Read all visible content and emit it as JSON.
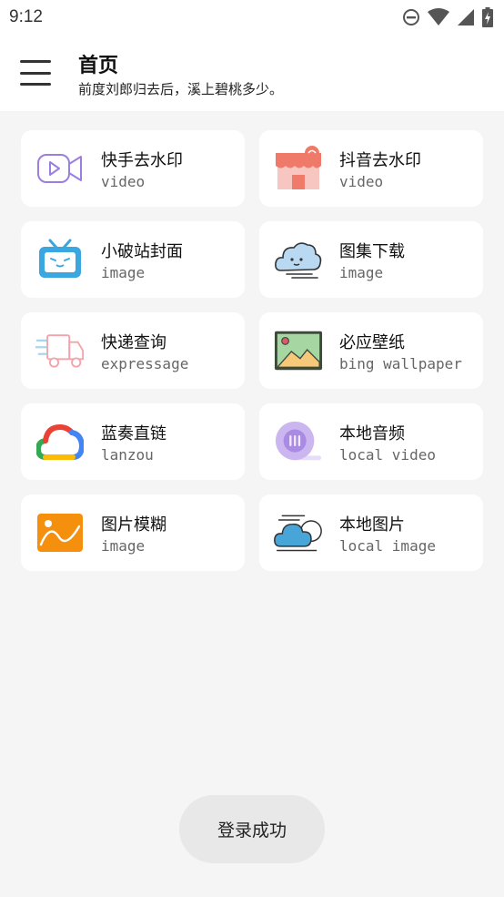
{
  "status_bar": {
    "time": "9:12",
    "icons": [
      "do-not-disturb-icon",
      "wifi-icon",
      "signal-icon",
      "battery-charging-icon"
    ]
  },
  "header": {
    "title": "首页",
    "subtitle": "前度刘郎归去后，溪上碧桃多少。",
    "menu_icon": "hamburger-menu-icon"
  },
  "cards": [
    {
      "title": "快手去水印",
      "subtitle": "video",
      "icon": "video-camera-icon"
    },
    {
      "title": "抖音去水印",
      "subtitle": "video",
      "icon": "storefront-icon"
    },
    {
      "title": "小破站封面",
      "subtitle": "image",
      "icon": "bilibili-tv-icon"
    },
    {
      "title": "图集下载",
      "subtitle": "image",
      "icon": "cloud-face-icon"
    },
    {
      "title": "快递查询",
      "subtitle": "expressage",
      "icon": "delivery-truck-icon"
    },
    {
      "title": "必应壁纸",
      "subtitle": "bing wallpaper",
      "icon": "landscape-picture-icon"
    },
    {
      "title": "蓝奏直链",
      "subtitle": "lanzou",
      "icon": "google-cloud-icon"
    },
    {
      "title": "本地音频",
      "subtitle": "local video",
      "icon": "audio-disc-icon"
    },
    {
      "title": "图片模糊",
      "subtitle": "image",
      "icon": "image-wave-icon"
    },
    {
      "title": "本地图片",
      "subtitle": "local image",
      "icon": "cloud-weather-icon"
    }
  ],
  "toast": {
    "message": "登录成功"
  },
  "colors": {
    "background": "#f5f5f5",
    "card": "#ffffff",
    "toast_bg": "#e8e8e8"
  }
}
